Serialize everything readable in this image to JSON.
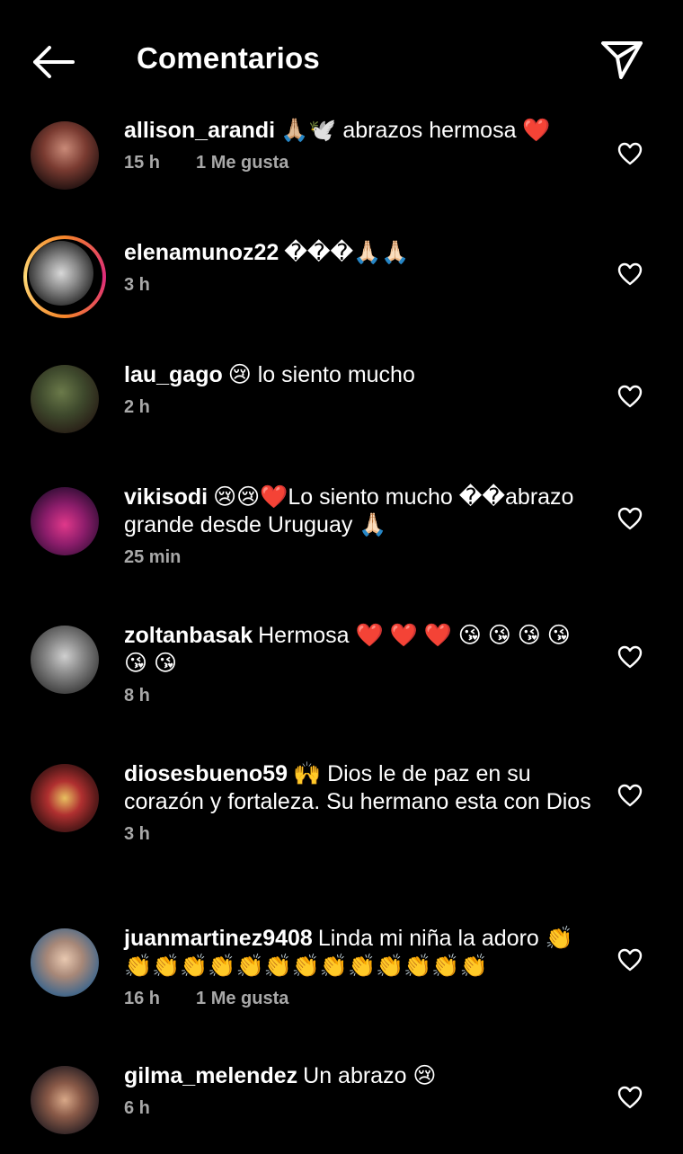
{
  "header": {
    "title": "Comentarios",
    "back_icon": "arrow-left-icon",
    "share_icon": "paper-plane-icon"
  },
  "comments": [
    {
      "user": "allison_arandi",
      "text": "🙏🏼🕊️ abrazos hermosa ❤️",
      "time": "15 h",
      "likes": "1 Me gusta"
    },
    {
      "user": "elenamunoz22",
      "text": "���🙏🏻🙏🏻",
      "time": "3 h",
      "likes": ""
    },
    {
      "user": "lau_gago",
      "text": "😢 lo siento mucho",
      "time": "2 h",
      "likes": ""
    },
    {
      "user": "vikisodi",
      "text": "😢😢❤️Lo siento mucho ��abrazo grande desde Uruguay 🙏🏻",
      "time": "25 min",
      "likes": ""
    },
    {
      "user": "zoltanbasak",
      "text": "Hermosa ❤️ ❤️ ❤️ 😘 😘 😘 😘 😘 😘",
      "time": "8 h",
      "likes": ""
    },
    {
      "user": "diosesbueno59",
      "text": "🙌 Dios le de paz en su corazón y fortaleza.  Su hermano esta con Dios",
      "time": "3 h",
      "likes": ""
    },
    {
      "user": "juanmartinez9408",
      "text": "Linda mi niña la adoro 👏 👏👏👏👏👏👏👏👏👏👏👏👏👏",
      "time": "16 h",
      "likes": "1 Me gusta"
    },
    {
      "user": "gilma_melendez",
      "text": "Un abrazo 😢",
      "time": "6 h",
      "likes": ""
    }
  ]
}
